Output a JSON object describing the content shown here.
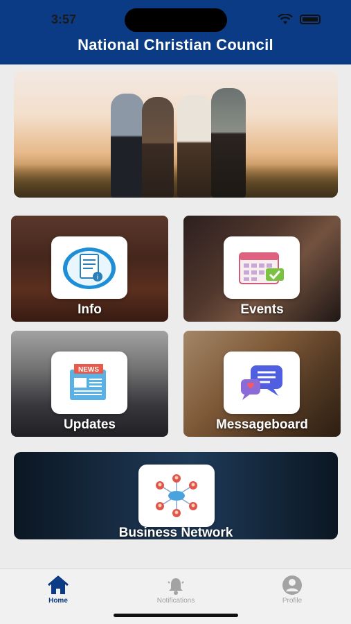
{
  "status_bar": {
    "time": "3:57"
  },
  "header": {
    "title": "National Christian Council"
  },
  "tiles": [
    {
      "label": "Info",
      "icon": "info-document-icon"
    },
    {
      "label": "Events",
      "icon": "calendar-icon"
    },
    {
      "label": "Updates",
      "icon": "news-icon"
    },
    {
      "label": "Messageboard",
      "icon": "chat-bubbles-icon"
    }
  ],
  "business": {
    "label": "Business Network",
    "icon": "network-icon"
  },
  "tabbar": {
    "items": [
      {
        "label": "Home",
        "icon": "home-icon",
        "active": true
      },
      {
        "label": "Notifications",
        "icon": "bell-icon",
        "active": false
      },
      {
        "label": "Profile",
        "icon": "user-icon",
        "active": false
      }
    ]
  },
  "colors": {
    "header": "#0b3b85",
    "active_tab": "#0b3b85",
    "inactive_tab": "#a3a3a3"
  }
}
